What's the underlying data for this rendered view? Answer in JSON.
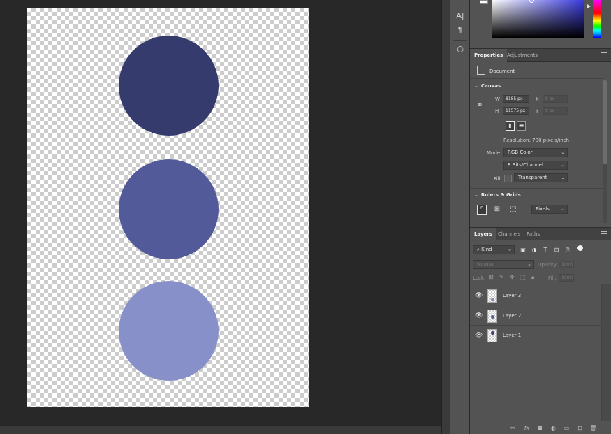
{
  "canvas": {
    "circles": [
      {
        "name": "circle-dark",
        "color": "#363b6e"
      },
      {
        "name": "circle-medium",
        "color": "#525a99"
      },
      {
        "name": "circle-light",
        "color": "#8890c9"
      }
    ]
  },
  "tools": [
    {
      "name": "character-tool-icon",
      "glyph": "A|"
    },
    {
      "name": "paragraph-tool-icon",
      "glyph": "¶"
    },
    {
      "name": "3d-cube-icon",
      "glyph": "⬡"
    }
  ],
  "properties": {
    "tabs": [
      {
        "label": "Properties",
        "active": true
      },
      {
        "label": "Adjustments",
        "active": false
      }
    ],
    "document_label": "Document",
    "canvas_section": "Canvas",
    "w_label": "W",
    "w_value": "8185 px",
    "h_label": "H",
    "h_value": "11575 px",
    "x_label": "X",
    "x_value": "0 px",
    "y_label": "Y",
    "y_value": "0 px",
    "resolution": "Resolution: 700 pixels/inch",
    "mode_label": "Mode",
    "mode_value": "RGB Color",
    "bits_value": "8 Bits/Channel",
    "fill_label": "Fill",
    "fill_value": "Transparent",
    "rulers_section": "Rulers & Grids",
    "units_value": "Pixels"
  },
  "layers": {
    "tabs": [
      {
        "label": "Layers",
        "active": true
      },
      {
        "label": "Channels",
        "active": false
      },
      {
        "label": "Paths",
        "active": false
      }
    ],
    "filter_kind": "Kind",
    "blend_mode": "Normal",
    "opacity_label": "Opacity:",
    "opacity_value": "100%",
    "lock_label": "Lock:",
    "fill_label": "Fill:",
    "fill_value": "100%",
    "items": [
      {
        "name": "Layer 3",
        "dot_color": "#8890c9"
      },
      {
        "name": "Layer 2",
        "dot_color": "#525a99"
      },
      {
        "name": "Layer 1",
        "dot_color": "#363b6e"
      }
    ]
  }
}
